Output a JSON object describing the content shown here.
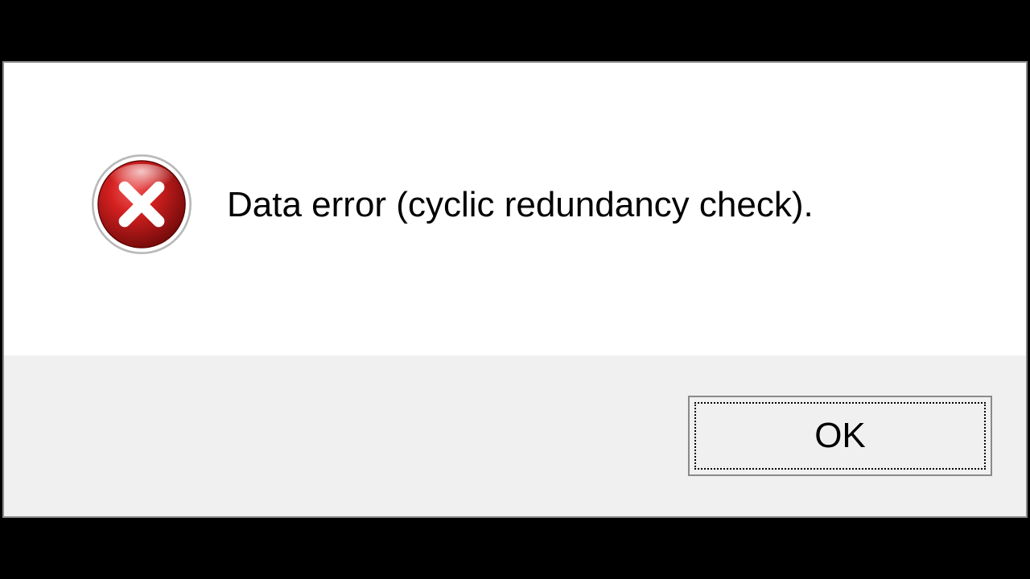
{
  "dialog": {
    "message": "Data error (cyclic redundancy check).",
    "ok_label": "OK",
    "icon": "error-x-icon"
  }
}
